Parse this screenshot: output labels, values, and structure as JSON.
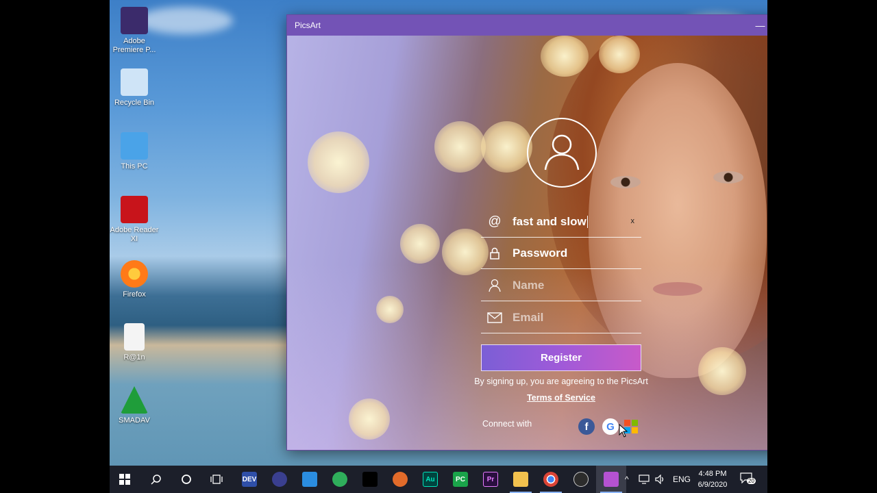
{
  "window": {
    "title": "PicsArt",
    "controls": {
      "minimize": "—",
      "maximize": "☐",
      "close": "✕"
    }
  },
  "form": {
    "username": {
      "icon": "@",
      "value": "fast and slow",
      "clear": "x"
    },
    "password": {
      "placeholder": "Password"
    },
    "name": {
      "placeholder": "Name"
    },
    "email": {
      "placeholder": "Email"
    },
    "register_label": "Register",
    "terms_text": "By signing up, you are agreeing to the PicsArt",
    "terms_link": "Terms of Service",
    "connect_label": "Connect with",
    "social": {
      "facebook": "f",
      "google": "G"
    }
  },
  "desktop": {
    "icons": [
      {
        "label": "Adobe Premiere P...",
        "color": "#3b2b6b"
      },
      {
        "label": "Recycle Bin",
        "color": "#cfe4f7"
      },
      {
        "label": "This PC",
        "color": "#4aa3e8"
      },
      {
        "label": "Adobe Reader XI",
        "color": "#c8141b"
      },
      {
        "label": "Firefox",
        "color": "#ff7a18"
      },
      {
        "label": "R@1n",
        "color": "#f4f4f4"
      },
      {
        "label": "SMADAV",
        "color": "#1f9d3a"
      }
    ]
  },
  "taskbar": {
    "apps": [
      {
        "label": "DEV",
        "color": "#2f4fa8"
      },
      {
        "label": "",
        "color": "#3a3f8f"
      },
      {
        "label": "",
        "color": "#2b8de0"
      },
      {
        "label": "",
        "color": "#2fae5b"
      },
      {
        "label": "",
        "color": "#000000"
      },
      {
        "label": "",
        "color": "#e26b2a"
      },
      {
        "label": "Au",
        "color": "#00443f"
      },
      {
        "label": "PC",
        "color": "#1aa34a"
      },
      {
        "label": "Pr",
        "color": "#2a0f3f"
      },
      {
        "label": "",
        "color": "#f2c14e"
      },
      {
        "label": "",
        "color": "#db4437"
      },
      {
        "label": "",
        "color": "#2c2c2c"
      },
      {
        "label": "",
        "color": "#b552d1"
      }
    ],
    "language": "ENG",
    "time": "4:48 PM",
    "date": "6/9/2020",
    "notifications": "20"
  },
  "colors": {
    "titlebar": "#7353b6",
    "register_gradient_start": "#7b5fd6",
    "register_gradient_end": "#c85ac9"
  }
}
